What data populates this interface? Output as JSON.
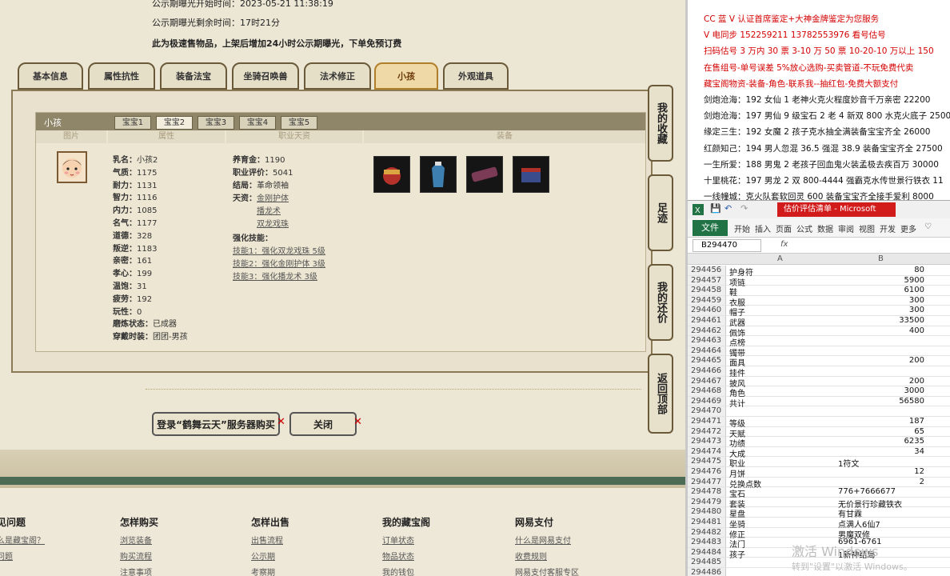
{
  "notice": {
    "start_label": "公示期曝光开始时间：",
    "start_value": "2023-05-21 11:38:19",
    "remain_label": "公示期曝光剩余时间：",
    "remain_value": "17时21分",
    "info": "此为极速售物品，上架后增加24小时公示期曝光，下单免预订费"
  },
  "tabs": [
    "基本信息",
    "属性抗性",
    "装备法宝",
    "坐骑召唤兽",
    "法术修正",
    "小孩",
    "外观道具"
  ],
  "active_tab": "小孩",
  "child_panel": {
    "title": "小孩",
    "baby_tabs": [
      "宝宝1",
      "宝宝2",
      "宝宝3",
      "宝宝4",
      "宝宝5"
    ],
    "active_baby": "宝宝2",
    "columns": [
      "图片",
      "属性",
      "职业天资",
      "装备"
    ],
    "stats": [
      {
        "k": "乳名：",
        "v": "小孩2"
      },
      {
        "k": "气质：",
        "v": "1175"
      },
      {
        "k": "耐力：",
        "v": "1131"
      },
      {
        "k": "智力：",
        "v": "1116"
      },
      {
        "k": "内力：",
        "v": "1085"
      },
      {
        "k": "名气：",
        "v": "1177"
      },
      {
        "k": "道德：",
        "v": "328"
      },
      {
        "k": "叛逆：",
        "v": "1183"
      },
      {
        "k": "亲密：",
        "v": "161"
      },
      {
        "k": "孝心：",
        "v": "199"
      },
      {
        "k": "温饱：",
        "v": "31"
      },
      {
        "k": "疲劳：",
        "v": "192"
      },
      {
        "k": "玩性：",
        "v": "0"
      },
      {
        "k": "磨炼状态：",
        "v": "已成器"
      },
      {
        "k": "穿戴时装：",
        "v": "团团-男孩"
      }
    ],
    "career": {
      "raise_label": "养育金：",
      "raise_value": "1190",
      "eval_label": "职业评价：",
      "eval_value": "5041",
      "ending_label": "结局：",
      "ending_value": "革命领袖",
      "talent_label": "天资：",
      "talents": [
        "金刚护体",
        "播龙术",
        "双龙戏珠"
      ],
      "skill_label": "强化技能：",
      "skills": [
        "技能1：强化双龙戏珠 5级",
        "技能2：强化金刚护体 3级",
        "技能3：强化播龙术 3级"
      ]
    }
  },
  "side_buttons": [
    "我的收藏",
    "足迹",
    "我的还价",
    "返回顶部"
  ],
  "buttons": {
    "buy": "登录“鹤舞云天”服务器购买",
    "close": "关闭"
  },
  "footer": [
    {
      "h": "见问题",
      "links": [
        "么是藏宝阁？",
        "问题"
      ]
    },
    {
      "h": "怎样购买",
      "links": [
        "浏览装备",
        "购买流程",
        "注意事项"
      ]
    },
    {
      "h": "怎样出售",
      "links": [
        "出售流程",
        "公示期",
        "考察期"
      ]
    },
    {
      "h": "我的藏宝阁",
      "links": [
        "订单状态",
        "物品状态",
        "我的钱包"
      ]
    },
    {
      "h": "网易支付",
      "links": [
        "什么是网易支付",
        "收费规则",
        "网易支付客服专区"
      ]
    }
  ],
  "ad_lines": [
    {
      "t": "CC 蓝 V 认证首席鉴定+大神金牌鉴定为您服务",
      "c": "#d40000"
    },
    {
      "t": "V 电同步 152259211   13782553976 看号估号",
      "c": "#d40000"
    },
    {
      "t": "扫码估号 3 万内 30 票 3-10 万 50 票   10-20-10 万以上 150",
      "c": "#d40000"
    },
    {
      "t": "在售组号-单号误差 5%放心选购-买卖管道-不玩免费代卖",
      "c": "#d40000"
    },
    {
      "t": "藏宝阁物资-装备-角色-联系我--抽红包-免费大额支付",
      "c": "#d40000"
    },
    {
      "t": "剑炮沧海：192 女仙 1 老神火克火程度妙音千万亲密 22200",
      "c": "#111"
    },
    {
      "t": "剑炮沧海：197 男仙 9 级宝石 2 老 4 新双 800 水克火底子 2500",
      "c": "#111"
    },
    {
      "t": "缘定三生：192 女魔 2 孩子克水抽全满装备宝宝齐全 26000",
      "c": "#111"
    },
    {
      "t": "红颜知己：194 男人忽混 36.5 强混 38.9 装备宝宝齐全 27500",
      "c": "#111"
    },
    {
      "t": "一生所爱：188 男鬼 2 老孩子回血鬼火装孟极去疾百万 30000",
      "c": "#111"
    },
    {
      "t": "十里桃花：197 男龙 2 双 800-4444 强霸克水传世景行铁衣 11",
      "c": "#111"
    },
    {
      "t": "一线幢城：克火队套软回灵 600 装备宝宝齐全接手爱利 8000",
      "c": "#111"
    }
  ],
  "excel": {
    "title": "估价评估清单 - Microsoft",
    "file_tab": "文件",
    "ribbon": [
      "开始",
      "插入",
      "页面",
      "公式",
      "数据",
      "审阅",
      "视图",
      "开发",
      "更多"
    ],
    "name_box": "B294470",
    "fx": "fx",
    "col_a": "A",
    "col_b": "B",
    "rows": [
      {
        "n": "294456",
        "a": "护身符",
        "b": "80"
      },
      {
        "n": "294457",
        "a": "项链",
        "b": "5900"
      },
      {
        "n": "294458",
        "a": "鞋",
        "b": "6100"
      },
      {
        "n": "294459",
        "a": "衣服",
        "b": "300"
      },
      {
        "n": "294460",
        "a": "帽子",
        "b": "300"
      },
      {
        "n": "294461",
        "a": "武器",
        "b": "33500"
      },
      {
        "n": "294462",
        "a": "佩饰",
        "b": "400"
      },
      {
        "n": "294463",
        "a": "点榜",
        "b": ""
      },
      {
        "n": "294464",
        "a": "镯带",
        "b": ""
      },
      {
        "n": "294465",
        "a": "面具",
        "b": "200"
      },
      {
        "n": "294466",
        "a": "挂件",
        "b": ""
      },
      {
        "n": "294467",
        "a": "披风",
        "b": "200"
      },
      {
        "n": "294468",
        "a": "角色",
        "b": "3000"
      },
      {
        "n": "294469",
        "a": "共计",
        "b": "56580"
      },
      {
        "n": "294470",
        "a": "",
        "b": ""
      },
      {
        "n": "294471",
        "a": "等级",
        "b": "187"
      },
      {
        "n": "294472",
        "a": "天赋",
        "b": "65"
      },
      {
        "n": "294473",
        "a": "功绩",
        "b": "6235"
      },
      {
        "n": "294474",
        "a": "大成",
        "b": "34"
      },
      {
        "n": "294475",
        "a": "职业",
        "b": "1符文",
        "txt": true
      },
      {
        "n": "294476",
        "a": "月饼",
        "b": "12"
      },
      {
        "n": "294477",
        "a": "兑换点数",
        "b": "2"
      },
      {
        "n": "294478",
        "a": "宝石",
        "b": "776+7666677",
        "txt": true
      },
      {
        "n": "294479",
        "a": "套装",
        "b": "无价景行珍藏铁衣",
        "txt": true
      },
      {
        "n": "294480",
        "a": "星盘",
        "b": "有甘霖",
        "txt": true
      },
      {
        "n": "294481",
        "a": "坐骑",
        "b": "点满人6仙7",
        "txt": true
      },
      {
        "n": "294482",
        "a": "修正",
        "b": "男魔双修",
        "txt": true
      },
      {
        "n": "294483",
        "a": "法门",
        "b": "6961-6761",
        "txt": true
      },
      {
        "n": "294484",
        "a": "孩子",
        "b": "1新神结局",
        "txt": true
      },
      {
        "n": "294485",
        "a": "",
        "b": ""
      },
      {
        "n": "294486",
        "a": "",
        "b": ""
      }
    ]
  },
  "watermark": {
    "line1": "激活 Windows",
    "line2": "转到\"设置\"以激活 Windows。"
  }
}
